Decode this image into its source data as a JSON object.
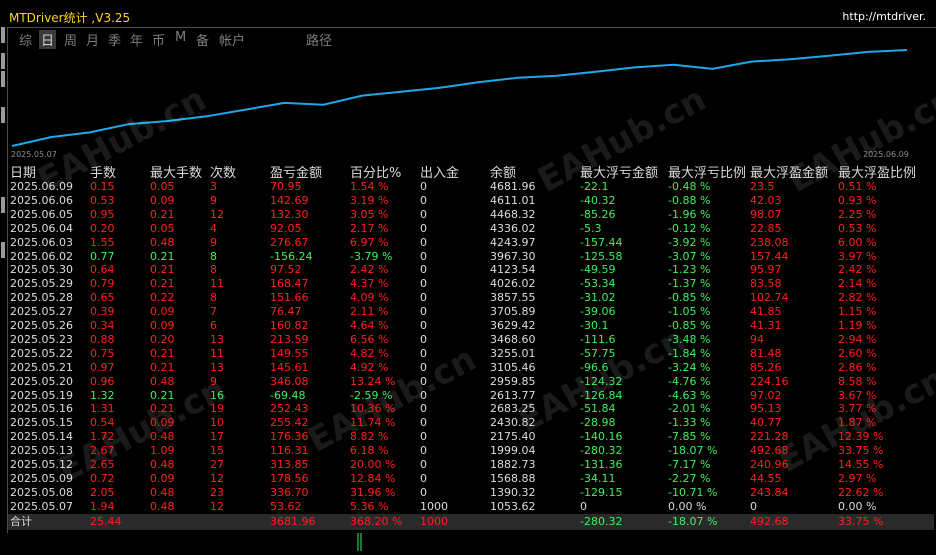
{
  "app": {
    "title": "MTDriver统计 ,V3.25",
    "url": "http://mtdriver."
  },
  "tabs": [
    {
      "label": "综"
    },
    {
      "label": "日"
    },
    {
      "label": "周"
    },
    {
      "label": "月"
    },
    {
      "label": "季"
    },
    {
      "label": "年"
    },
    {
      "label": "币"
    },
    {
      "label": "M"
    },
    {
      "label": "备"
    },
    {
      "label": "帐户"
    },
    {
      "label": "路径"
    }
  ],
  "active_tab": "日",
  "chart_data": {
    "type": "line",
    "x_start_label": "2025.05.07",
    "x_end_label": "2025.06.09",
    "series_color": "#1ea8e8",
    "values": [
      1053.62,
      1390.32,
      1568.88,
      1882.73,
      1999.04,
      2175.4,
      2430.82,
      2683.25,
      2613.77,
      2959.85,
      3105.46,
      3255.01,
      3468.6,
      3629.42,
      3705.89,
      3857.55,
      4026.02,
      4123.54,
      3967.3,
      4243.97,
      4336.02,
      4468.32,
      4611.01,
      4681.96
    ]
  },
  "table": {
    "headers": [
      "日期",
      "手数",
      "最大手数",
      "次数",
      "盈亏金额",
      "百分比%",
      "出入金",
      "余额",
      "最大浮亏金额",
      "最大浮亏比例",
      "最大浮盈金额",
      "最大浮盈比例"
    ],
    "rows": [
      [
        "2025.06.09",
        "0.15",
        "0.05",
        "3",
        "70.95",
        "1.54 %",
        "0",
        "4681.96",
        "-22.1",
        "-0.48 %",
        "23.5",
        "0.51 %"
      ],
      [
        "2025.06.06",
        "0.53",
        "0.09",
        "9",
        "142.69",
        "3.19 %",
        "0",
        "4611.01",
        "-40.32",
        "-0.88 %",
        "42.03",
        "0.93 %"
      ],
      [
        "2025.06.05",
        "0.95",
        "0.21",
        "12",
        "132.30",
        "3.05 %",
        "0",
        "4468.32",
        "-85.26",
        "-1.96 %",
        "98.07",
        "2.25 %"
      ],
      [
        "2025.06.04",
        "0.20",
        "0.05",
        "4",
        "92.05",
        "2.17 %",
        "0",
        "4336.02",
        "-5.3",
        "-0.12 %",
        "22.85",
        "0.53 %"
      ],
      [
        "2025.06.03",
        "1.55",
        "0.48",
        "9",
        "276.67",
        "6.97 %",
        "0",
        "4243.97",
        "-157.44",
        "-3.92 %",
        "238.08",
        "6.00 %"
      ],
      [
        "2025.06.02",
        "0.77",
        "0.21",
        "8",
        "-156.24",
        "-3.79 %",
        "0",
        "3967.30",
        "-125.58",
        "-3.07 %",
        "157.44",
        "3.97 %"
      ],
      [
        "2025.05.30",
        "0.64",
        "0.21",
        "8",
        "97.52",
        "2.42 %",
        "0",
        "4123.54",
        "-49.59",
        "-1.23 %",
        "95.97",
        "2.42 %"
      ],
      [
        "2025.05.29",
        "0.79",
        "0.21",
        "11",
        "168.47",
        "4.37 %",
        "0",
        "4026.02",
        "-53.34",
        "-1.37 %",
        "83.58",
        "2.14 %"
      ],
      [
        "2025.05.28",
        "0.65",
        "0.22",
        "8",
        "151.66",
        "4.09 %",
        "0",
        "3857.55",
        "-31.02",
        "-0.85 %",
        "102.74",
        "2.82 %"
      ],
      [
        "2025.05.27",
        "0.39",
        "0.09",
        "7",
        "76.47",
        "2.11 %",
        "0",
        "3705.89",
        "-39.06",
        "-1.05 %",
        "41.85",
        "1.15 %"
      ],
      [
        "2025.05.26",
        "0.34",
        "0.09",
        "6",
        "160.82",
        "4.64 %",
        "0",
        "3629.42",
        "-30.1",
        "-0.85 %",
        "41.31",
        "1.19 %"
      ],
      [
        "2025.05.23",
        "0.88",
        "0.20",
        "13",
        "213.59",
        "6.56 %",
        "0",
        "3468.60",
        "-111.6",
        "-3.48 %",
        "94",
        "2.94 %"
      ],
      [
        "2025.05.22",
        "0.75",
        "0.21",
        "11",
        "149.55",
        "4.82 %",
        "0",
        "3255.01",
        "-57.75",
        "-1.84 %",
        "81.48",
        "2.60 %"
      ],
      [
        "2025.05.21",
        "0.97",
        "0.21",
        "13",
        "145.61",
        "4.92 %",
        "0",
        "3105.46",
        "-96.6",
        "-3.24 %",
        "85.26",
        "2.86 %"
      ],
      [
        "2025.05.20",
        "0.96",
        "0.48",
        "9",
        "346.08",
        "13.24 %",
        "0",
        "2959.85",
        "-124.32",
        "-4.76 %",
        "224.16",
        "8.58 %"
      ],
      [
        "2025.05.19",
        "1.32",
        "0.21",
        "16",
        "-69.48",
        "-2.59 %",
        "0",
        "2613.77",
        "-126.84",
        "-4.63 %",
        "97.02",
        "3.67 %"
      ],
      [
        "2025.05.16",
        "1.31",
        "0.21",
        "19",
        "252.43",
        "10.36 %",
        "0",
        "2683.25",
        "-51.84",
        "-2.01 %",
        "95.13",
        "3.77 %"
      ],
      [
        "2025.05.15",
        "0.54",
        "0.09",
        "10",
        "255.42",
        "11.74 %",
        "0",
        "2430.82",
        "-28.98",
        "-1.33 %",
        "40.77",
        "1.87 %"
      ],
      [
        "2025.05.14",
        "1.72",
        "0.48",
        "17",
        "176.36",
        "8.82 %",
        "0",
        "2175.40",
        "-140.16",
        "-7.85 %",
        "221.28",
        "12.39 %"
      ],
      [
        "2025.05.13",
        "2.67",
        "1.09",
        "15",
        "116.31",
        "6.18 %",
        "0",
        "1999.04",
        "-280.32",
        "-18.07 %",
        "492.68",
        "33.75 %"
      ],
      [
        "2025.05.12",
        "2.65",
        "0.48",
        "27",
        "313.85",
        "20.00 %",
        "0",
        "1882.73",
        "-131.36",
        "-7.17 %",
        "240.96",
        "14.55 %"
      ],
      [
        "2025.05.09",
        "0.72",
        "0.09",
        "12",
        "178.56",
        "12.84 %",
        "0",
        "1568.88",
        "-34.11",
        "-2.27 %",
        "44.55",
        "2.97 %"
      ],
      [
        "2025.05.08",
        "2.05",
        "0.48",
        "23",
        "336.70",
        "31.96 %",
        "0",
        "1390.32",
        "-129.15",
        "-10.71 %",
        "243.84",
        "22.62 %"
      ],
      [
        "2025.05.07",
        "1.94",
        "0.48",
        "12",
        "53.62",
        "5.36 %",
        "1000",
        "1053.62",
        "0",
        "0.00 %",
        "0",
        "0.00 %"
      ]
    ],
    "total": [
      "合计",
      "25.44",
      "",
      "",
      "3681.96",
      "368.20 %",
      "1000",
      "",
      "-280.32",
      "-18.07 %",
      "492.68",
      "33.75 %"
    ]
  },
  "watermark": "EAHub.cn"
}
